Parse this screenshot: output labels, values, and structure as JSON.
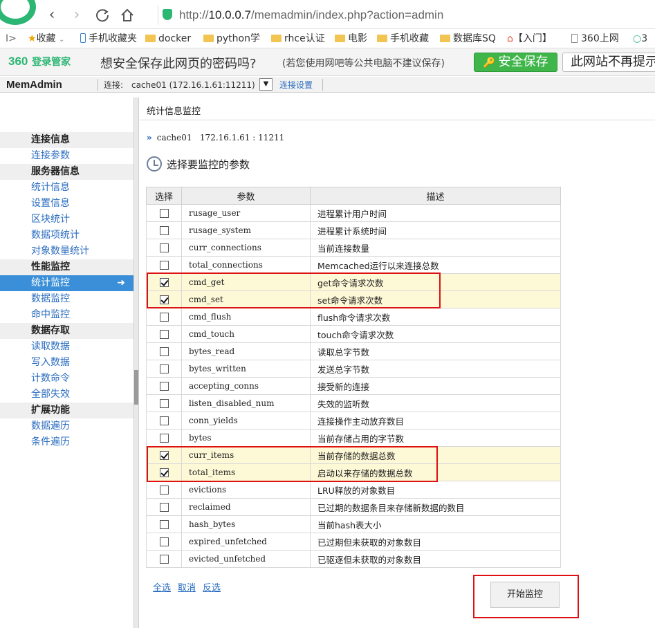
{
  "browser": {
    "url_prefix": "http://",
    "url_host": "10.0.0.7",
    "url_path": "/memadmin/index.php?action=admin",
    "bookmarks": [
      {
        "label": "收藏",
        "icon": "star-icon"
      },
      {
        "label": "手机收藏夹",
        "icon": "phone-icon"
      },
      {
        "label": "docker",
        "icon": "folder-icon"
      },
      {
        "label": "python学",
        "icon": "folder-icon"
      },
      {
        "label": "rhce认证",
        "icon": "folder-icon"
      },
      {
        "label": "电影",
        "icon": "folder-icon"
      },
      {
        "label": "手机收藏",
        "icon": "folder-icon"
      },
      {
        "label": "数据库SQ",
        "icon": "folder-icon"
      },
      {
        "label": "【入门】",
        "icon": "home-icon"
      },
      {
        "label": "360上网",
        "icon": "page-icon"
      },
      {
        "label": "3",
        "icon": "search-icon"
      }
    ]
  },
  "password_bar": {
    "brand": "360",
    "brand_sub": "登录管家",
    "question": "想安全保存此网页的密码吗?",
    "hint": "(若您使用网吧等公共电脑不建议保存)",
    "save_label": "安全保存",
    "never_label": "此网站不再提示"
  },
  "app": {
    "title": "MemAdmin",
    "conn_label": "连接:",
    "conn_value": "cache01 (172.16.1.61:11211)",
    "conn_settings": "连接设置"
  },
  "sidebar": {
    "groups": [
      {
        "label": "连接信息",
        "items": [
          "连接参数"
        ]
      },
      {
        "label": "服务器信息",
        "items": [
          "统计信息",
          "设置信息",
          "区块统计",
          "数据项统计",
          "对象数量统计"
        ]
      },
      {
        "label": "性能监控",
        "items": [
          "统计监控",
          "数据监控",
          "命中监控"
        ]
      },
      {
        "label": "数据存取",
        "items": [
          "读取数据",
          "写入数据",
          "计数命令",
          "全部失效"
        ]
      },
      {
        "label": "扩展功能",
        "items": [
          "数据遍历",
          "条件遍历"
        ]
      }
    ],
    "active_item": "统计监控"
  },
  "main": {
    "title": "统计信息监控",
    "server_name": "cache01",
    "server_addr": "172.16.1.61 : 11211",
    "section_heading": "选择要监控的参数",
    "columns": [
      "选择",
      "参数",
      "描述"
    ],
    "rows": [
      {
        "param": "rusage_user",
        "desc": "进程累计用户时间",
        "checked": false
      },
      {
        "param": "rusage_system",
        "desc": "进程累计系统时间",
        "checked": false
      },
      {
        "param": "curr_connections",
        "desc": "当前连接数量",
        "checked": false
      },
      {
        "param": "total_connections",
        "desc": "Memcached运行以来连接总数",
        "checked": false
      },
      {
        "param": "cmd_get",
        "desc": "get命令请求次数",
        "checked": true
      },
      {
        "param": "cmd_set",
        "desc": "set命令请求次数",
        "checked": true
      },
      {
        "param": "cmd_flush",
        "desc": "flush命令请求次数",
        "checked": false
      },
      {
        "param": "cmd_touch",
        "desc": "touch命令请求次数",
        "checked": false
      },
      {
        "param": "bytes_read",
        "desc": "读取总字节数",
        "checked": false
      },
      {
        "param": "bytes_written",
        "desc": "发送总字节数",
        "checked": false
      },
      {
        "param": "accepting_conns",
        "desc": "接受新的连接",
        "checked": false
      },
      {
        "param": "listen_disabled_num",
        "desc": "失效的监听数",
        "checked": false
      },
      {
        "param": "conn_yields",
        "desc": "连接操作主动放弃数目",
        "checked": false
      },
      {
        "param": "bytes",
        "desc": "当前存储占用的字节数",
        "checked": false
      },
      {
        "param": "curr_items",
        "desc": "当前存储的数据总数",
        "checked": true
      },
      {
        "param": "total_items",
        "desc": "启动以来存储的数据总数",
        "checked": true
      },
      {
        "param": "evictions",
        "desc": "LRU释放的对象数目",
        "checked": false
      },
      {
        "param": "reclaimed",
        "desc": "已过期的数据条目来存储新数据的数目",
        "checked": false
      },
      {
        "param": "hash_bytes",
        "desc": "当前hash表大小",
        "checked": false
      },
      {
        "param": "expired_unfetched",
        "desc": "已过期但未获取的对象数目",
        "checked": false
      },
      {
        "param": "evicted_unfetched",
        "desc": "已驱逐但未获取的对象数目",
        "checked": false
      }
    ],
    "select_all": "全选",
    "cancel": "取消",
    "invert": "反选",
    "start_label": "开始监控"
  },
  "colors": {
    "accent": "#2a6cc0",
    "active_nav": "#3a8fd8",
    "highlight": "#d11111",
    "brand_green": "#2bb673"
  }
}
